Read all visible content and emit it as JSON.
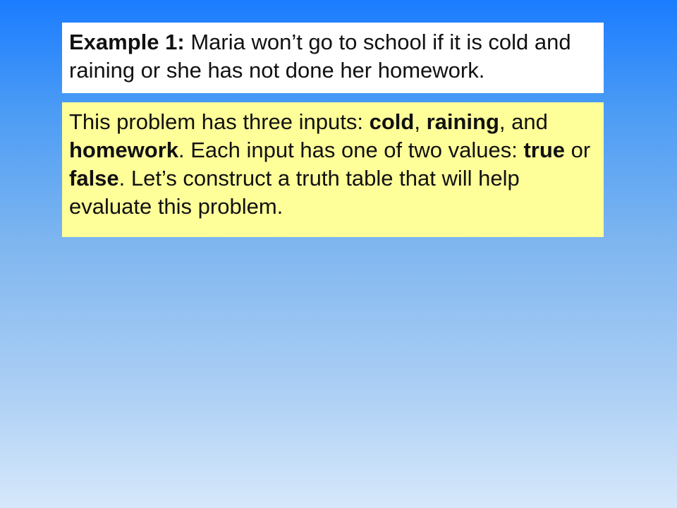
{
  "example": {
    "label": "Example 1:",
    "text": " Maria won’t go to school if it is cold and raining or she has not done her homework."
  },
  "explanation": {
    "segments": [
      {
        "text": "This problem has three inputs: ",
        "bold": false
      },
      {
        "text": "cold",
        "bold": true
      },
      {
        "text": ", ",
        "bold": false
      },
      {
        "text": "raining",
        "bold": true
      },
      {
        "text": ", and ",
        "bold": false
      },
      {
        "text": "homework",
        "bold": true
      },
      {
        "text": ". Each input has one of two values: ",
        "bold": false
      },
      {
        "text": "true",
        "bold": true
      },
      {
        "text": " or ",
        "bold": false
      },
      {
        "text": "false",
        "bold": true
      },
      {
        "text": ". Let’s construct a truth table that will help evaluate this problem.",
        "bold": false
      }
    ]
  }
}
